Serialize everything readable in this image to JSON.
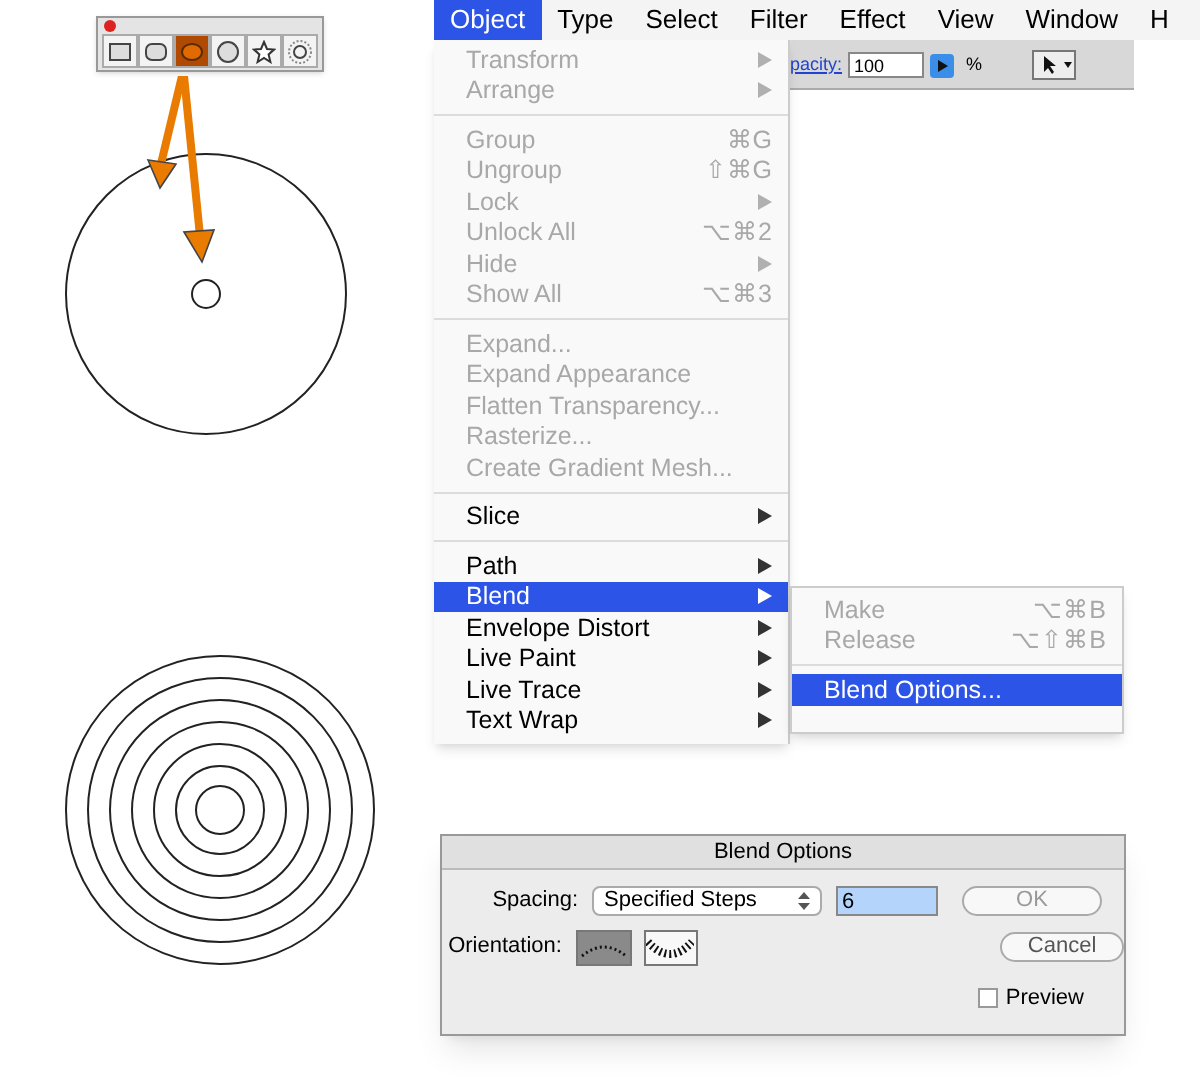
{
  "toolbar": {
    "tools": [
      {
        "kind": "rectangle",
        "selected": false
      },
      {
        "kind": "rounded",
        "selected": false
      },
      {
        "kind": "ellipse",
        "selected": true
      },
      {
        "kind": "polygon",
        "selected": false
      },
      {
        "kind": "star",
        "selected": false
      },
      {
        "kind": "flare",
        "selected": false
      }
    ]
  },
  "menubar": {
    "items": [
      {
        "label": "Object",
        "selected": true
      },
      {
        "label": "Type",
        "selected": false
      },
      {
        "label": "Select",
        "selected": false
      },
      {
        "label": "Filter",
        "selected": false
      },
      {
        "label": "Effect",
        "selected": false
      },
      {
        "label": "View",
        "selected": false
      },
      {
        "label": "Window",
        "selected": false
      },
      {
        "label": "H",
        "selected": false
      }
    ]
  },
  "control_bar": {
    "opacity_label": "pacity:",
    "opacity_value": "100",
    "unit": "%"
  },
  "object_menu": {
    "items": [
      {
        "kind": "item",
        "label": "Transform",
        "disabled": true,
        "submenu": true,
        "selected": false
      },
      {
        "kind": "item",
        "label": "Arrange",
        "disabled": true,
        "submenu": true,
        "selected": false
      },
      {
        "kind": "separator"
      },
      {
        "kind": "item",
        "label": "Group",
        "shortcut": "⌘G",
        "disabled": true,
        "selected": false
      },
      {
        "kind": "item",
        "label": "Ungroup",
        "shortcut": "⇧⌘G",
        "disabled": true,
        "selected": false
      },
      {
        "kind": "item",
        "label": "Lock",
        "disabled": true,
        "submenu": true,
        "selected": false
      },
      {
        "kind": "item",
        "label": "Unlock All",
        "shortcut": "⌥⌘2",
        "disabled": true,
        "selected": false
      },
      {
        "kind": "item",
        "label": "Hide",
        "disabled": true,
        "submenu": true,
        "selected": false
      },
      {
        "kind": "item",
        "label": "Show All",
        "shortcut": "⌥⌘3",
        "disabled": true,
        "selected": false
      },
      {
        "kind": "separator"
      },
      {
        "kind": "item",
        "label": "Expand...",
        "disabled": true,
        "selected": false
      },
      {
        "kind": "item",
        "label": "Expand Appearance",
        "disabled": true,
        "selected": false
      },
      {
        "kind": "item",
        "label": "Flatten Transparency...",
        "disabled": true,
        "selected": false
      },
      {
        "kind": "item",
        "label": "Rasterize...",
        "disabled": true,
        "selected": false
      },
      {
        "kind": "item",
        "label": "Create Gradient Mesh...",
        "disabled": true,
        "selected": false
      },
      {
        "kind": "separator"
      },
      {
        "kind": "item",
        "label": "Slice",
        "disabled": false,
        "submenu": true,
        "selected": false
      },
      {
        "kind": "separator"
      },
      {
        "kind": "item",
        "label": "Path",
        "disabled": false,
        "submenu": true,
        "selected": false
      },
      {
        "kind": "item",
        "label": "Blend",
        "disabled": false,
        "submenu": true,
        "selected": true
      },
      {
        "kind": "item",
        "label": "Envelope Distort",
        "disabled": false,
        "submenu": true,
        "selected": false
      },
      {
        "kind": "item",
        "label": "Live Paint",
        "disabled": false,
        "submenu": true,
        "selected": false
      },
      {
        "kind": "item",
        "label": "Live Trace",
        "disabled": false,
        "submenu": true,
        "selected": false
      },
      {
        "kind": "item",
        "label": "Text Wrap",
        "disabled": false,
        "submenu": true,
        "selected": false
      }
    ]
  },
  "blend_menu": {
    "items": [
      {
        "kind": "item",
        "label": "Make",
        "shortcut": "⌥⌘B",
        "disabled": true,
        "selected": false
      },
      {
        "kind": "item",
        "label": "Release",
        "shortcut": "⌥⇧⌘B",
        "disabled": true,
        "selected": false
      },
      {
        "kind": "separator"
      },
      {
        "kind": "item",
        "label": "Blend Options...",
        "disabled": false,
        "selected": true
      }
    ]
  },
  "dialog": {
    "title": "Blend Options",
    "spacing_label": "Spacing:",
    "spacing_value": "Specified Steps",
    "steps_value": "6",
    "orientation_label": "Orientation:",
    "orientations": [
      {
        "kind": "page",
        "selected": true
      },
      {
        "kind": "path",
        "selected": false
      }
    ],
    "buttons": [
      {
        "label": "OK",
        "disabled": true
      },
      {
        "label": "Cancel",
        "disabled": false
      }
    ],
    "preview": {
      "label": "Preview",
      "checked": false
    }
  }
}
